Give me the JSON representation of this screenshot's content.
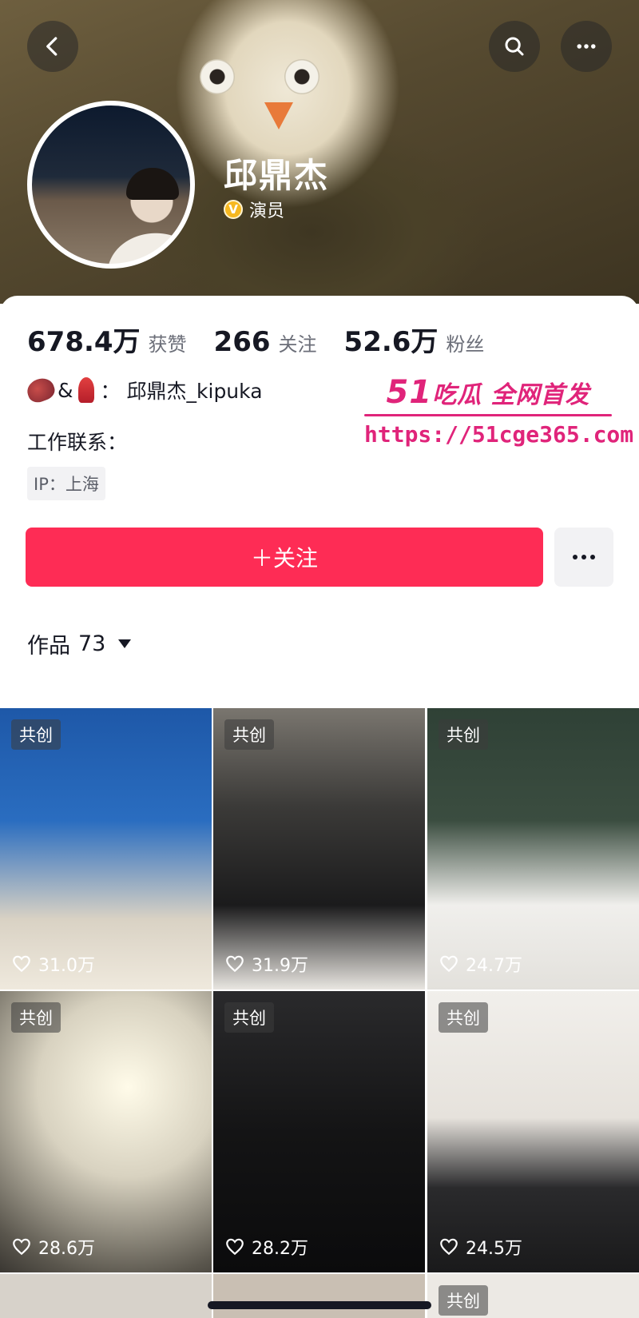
{
  "header": {
    "name": "邱鼎杰",
    "verified_label": "演员",
    "icons": {
      "back": "back-arrow-icon",
      "search": "search-icon",
      "more": "more-icon"
    }
  },
  "stats": [
    {
      "value": "678.4万",
      "label": "获赞"
    },
    {
      "value": "266",
      "label": "关注"
    },
    {
      "value": "52.6万",
      "label": "粉丝"
    }
  ],
  "bio": {
    "amp": "&",
    "colon": "：",
    "handle": "邱鼎杰_kipuka"
  },
  "contact": {
    "label": "工作联系："
  },
  "ip": {
    "label": "IP：上海"
  },
  "actions": {
    "follow_label": "＋关注"
  },
  "works": {
    "label": "作品",
    "count": "73"
  },
  "watermark": {
    "brand": "51吃瓜 全网首发",
    "brand_num": "51",
    "brand_text": "吃瓜 全网首发",
    "url": "https://51cge365.com"
  },
  "tiles": [
    {
      "badge": "共创",
      "likes": "31.0万"
    },
    {
      "badge": "共创",
      "likes": "31.9万"
    },
    {
      "badge": "共创",
      "likes": "24.7万"
    },
    {
      "badge": "共创",
      "likes": "28.6万"
    },
    {
      "badge": "共创",
      "likes": "28.2万"
    },
    {
      "badge": "共创",
      "likes": "24.5万"
    },
    {
      "badge": "共创",
      "likes": ""
    }
  ],
  "colors": {
    "accent": "#fe2c55",
    "watermark": "#e0247a",
    "verified": "#f6b821"
  }
}
